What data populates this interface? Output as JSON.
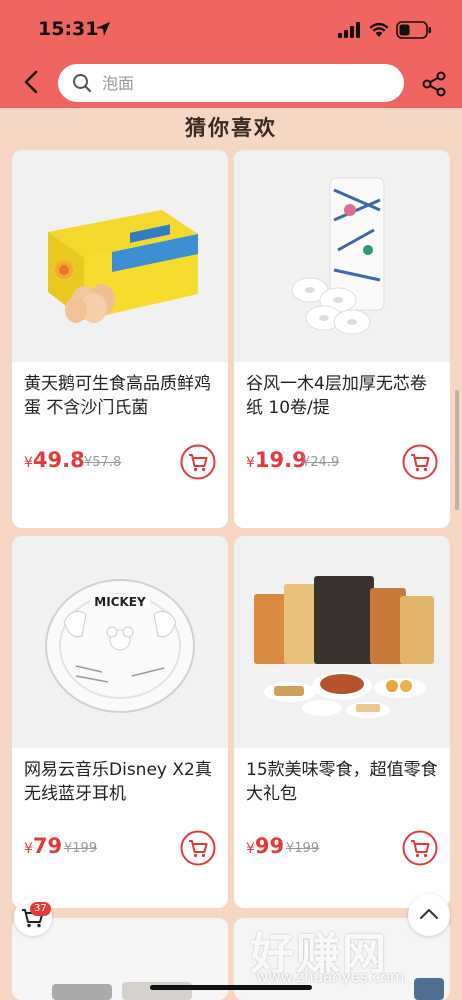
{
  "status": {
    "time": "15:31"
  },
  "search": {
    "placeholder": "泡面"
  },
  "section": {
    "title": "猜你喜欢"
  },
  "products": [
    {
      "name": "黄天鹅可生食高品质鲜鸡蛋 不含沙门氏菌",
      "currency": "¥",
      "price": "49.8",
      "old_price": "¥57.8"
    },
    {
      "name": "谷风一木4层加厚无芯卷纸 10卷/提",
      "currency": "¥",
      "price": "19.9",
      "old_price": "¥24.9"
    },
    {
      "name": "网易云音乐Disney X2真无线蓝牙耳机",
      "currency": "¥",
      "price": "79",
      "old_price": "¥199"
    },
    {
      "name": "15款美味零食，超值零食大礼包",
      "currency": "¥",
      "price": "99",
      "old_price": "¥199"
    }
  ],
  "float_cart": {
    "badge": "37"
  },
  "watermark": {
    "text": "好赚网",
    "url": "www.zhuanyes.com"
  },
  "colors": {
    "header": "#f0655f",
    "page_bg": "#f7d6c4",
    "price": "#e6393a"
  }
}
